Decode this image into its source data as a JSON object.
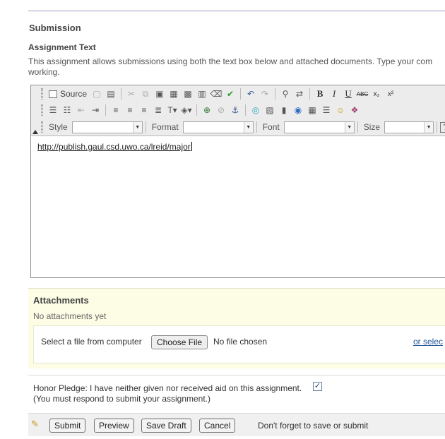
{
  "section": {
    "title": "Submission"
  },
  "assignment_text": {
    "label": "Assignment Text",
    "instructions_line1": "This assignment allows submissions using both the text box below and attached documents. Type your com",
    "instructions_line2": "working."
  },
  "editor": {
    "toolbar": {
      "source_label": "Source",
      "style_label": "Style",
      "format_label": "Format",
      "font_label": "Font",
      "size_label": "Size"
    },
    "content": "http://publish.gaul.csd.uwo.ca/lreid/major"
  },
  "attachments": {
    "title": "Attachments",
    "empty_text": "No attachments yet",
    "select_label": "Select a file from computer",
    "choose_button": "Choose File",
    "no_file_text": "No file chosen",
    "or_select_link": "or selec"
  },
  "honor_pledge": {
    "text": "Honor Pledge: I have neither given nor received aid on this assignment.",
    "note": "(You must respond to submit your assignment.)",
    "checked": true
  },
  "actions": {
    "submit": "Submit",
    "preview": "Preview",
    "save_draft": "Save Draft",
    "cancel": "Cancel",
    "reminder": "Don't forget to save or submit"
  },
  "colors": {
    "attachments_bg": "#fdfde6",
    "link": "#225599",
    "toolbar_bg": "#ececec"
  }
}
